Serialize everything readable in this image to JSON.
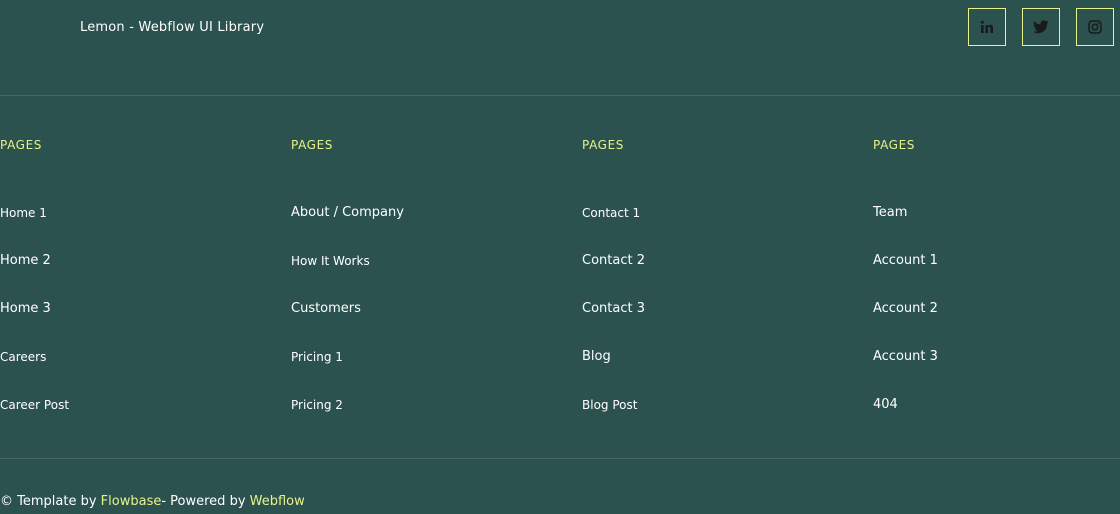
{
  "header": {
    "brand": "Lemon - Webflow UI Library",
    "social": [
      {
        "icon": "linkedin-icon",
        "label": "in"
      },
      {
        "icon": "twitter-icon"
      },
      {
        "icon": "instagram-icon"
      }
    ]
  },
  "columns": [
    {
      "heading": "PAGES",
      "links": [
        "Home 1",
        "Home 2",
        "Home 3",
        "Careers",
        "Career Post"
      ]
    },
    {
      "heading": "PAGES",
      "links": [
        "About / Company",
        "How It Works",
        "Customers",
        "Pricing 1",
        "Pricing 2"
      ]
    },
    {
      "heading": "PAGES",
      "links": [
        "Contact 1",
        "Contact 2",
        "Contact 3",
        "Blog",
        "Blog Post"
      ]
    },
    {
      "heading": "PAGES",
      "links": [
        "Team",
        "Account 1",
        "Account 2",
        "Account 3",
        "404"
      ]
    }
  ],
  "footer": {
    "prefix": "© Template by ",
    "flowbase": "Flowbase",
    "middle": "- Powered by ",
    "webflow": "Webflow"
  },
  "colors": {
    "background": "#2b524e",
    "accent": "#e7f28a",
    "text": "#ffffff"
  }
}
